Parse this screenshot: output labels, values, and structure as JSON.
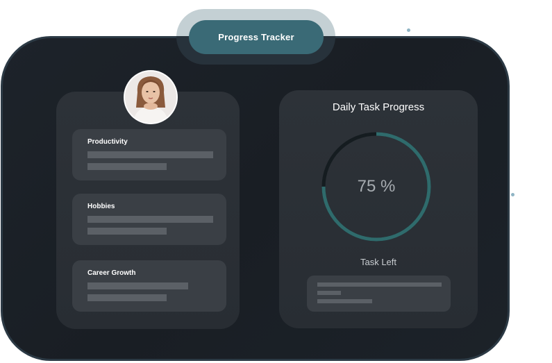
{
  "header": {
    "title": "Progress Tracker"
  },
  "profile": {
    "avatar": "woman-portrait"
  },
  "categories": [
    {
      "label": "Productivity"
    },
    {
      "label": "Hobbies"
    },
    {
      "label": "Career Growth"
    }
  ],
  "daily_progress": {
    "title": "Daily Task Progress",
    "percent": 75,
    "percent_label": "75 %",
    "tasks_left_label": "Task Left"
  },
  "colors": {
    "accent": "#3a6a76",
    "ring": "#2f6b6c",
    "background": "#1b2026",
    "panel": "#2b3036",
    "card": "#3a3f45"
  }
}
